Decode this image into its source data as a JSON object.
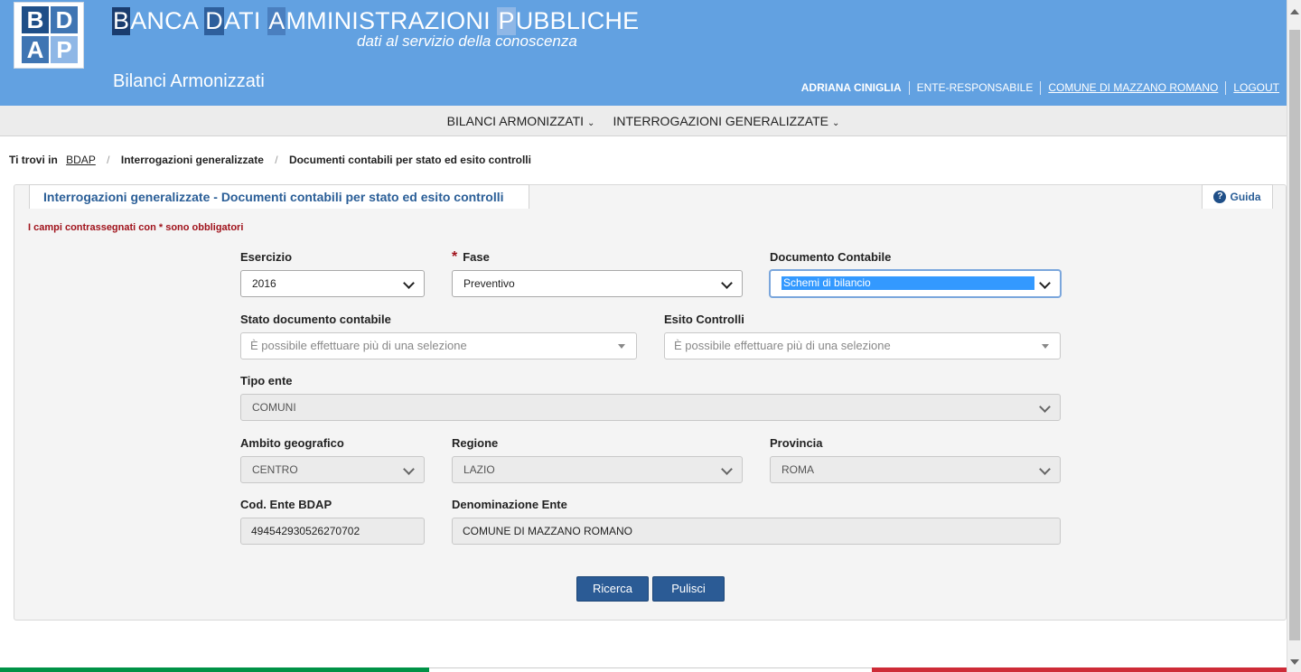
{
  "header": {
    "logo_letters": [
      "B",
      "D",
      "A",
      "P"
    ],
    "title_parts": [
      {
        "hl": "B",
        "rest": "ANCA "
      },
      {
        "hl": "D",
        "rest": "ATI "
      },
      {
        "hl": "A",
        "rest": "MMINISTRAZIONI "
      },
      {
        "hl": "P",
        "rest": "UBBLICHE"
      }
    ],
    "subtitle": "dati al servizio della conoscenza",
    "app_name": "Bilanci Armonizzati",
    "user": {
      "name": "ADRIANA CINIGLIA",
      "role": "ENTE-RESPONSABILE",
      "entity": "COMUNE DI MAZZANO ROMANO",
      "logout": "LOGOUT"
    }
  },
  "nav": {
    "items": [
      "BILANCI ARMONIZZATI",
      "INTERROGAZIONI GENERALIZZATE"
    ]
  },
  "breadcrumb": {
    "label": "Ti trovi in",
    "items": [
      "BDAP",
      "Interrogazioni generalizzate",
      "Documenti contabili per stato ed esito controlli"
    ]
  },
  "panel": {
    "title": "Interrogazioni generalizzate - Documenti contabili per stato ed esito controlli",
    "guide_label": "Guida",
    "required_note": "I campi contrassegnati con * sono obbligatori"
  },
  "form": {
    "esercizio": {
      "label": "Esercizio",
      "value": "2016"
    },
    "fase": {
      "label": "Fase",
      "required_mark": "*",
      "value": "Preventivo"
    },
    "documento": {
      "label": "Documento Contabile",
      "value": "Schemi di bilancio"
    },
    "stato": {
      "label": "Stato documento contabile",
      "placeholder": "È possibile effettuare più di una selezione"
    },
    "esito": {
      "label": "Esito Controlli",
      "placeholder": "È possibile effettuare più di una selezione"
    },
    "tipo_ente": {
      "label": "Tipo ente",
      "value": "COMUNI"
    },
    "ambito": {
      "label": "Ambito geografico",
      "value": "CENTRO"
    },
    "regione": {
      "label": "Regione",
      "value": "LAZIO"
    },
    "provincia": {
      "label": "Provincia",
      "value": "ROMA"
    },
    "cod_ente": {
      "label": "Cod. Ente BDAP",
      "value": "494542930526270702"
    },
    "denominazione": {
      "label": "Denominazione Ente",
      "value": "COMUNE DI MAZZANO ROMANO"
    }
  },
  "buttons": {
    "search": "Ricerca",
    "clear": "Pulisci"
  },
  "colors": {
    "header_bg": "#62a1e1",
    "primary_button": "#2b5b95",
    "required": "#a0131c",
    "flag_green": "#009246",
    "flag_white": "#ffffff",
    "flag_red": "#ce2b37"
  }
}
